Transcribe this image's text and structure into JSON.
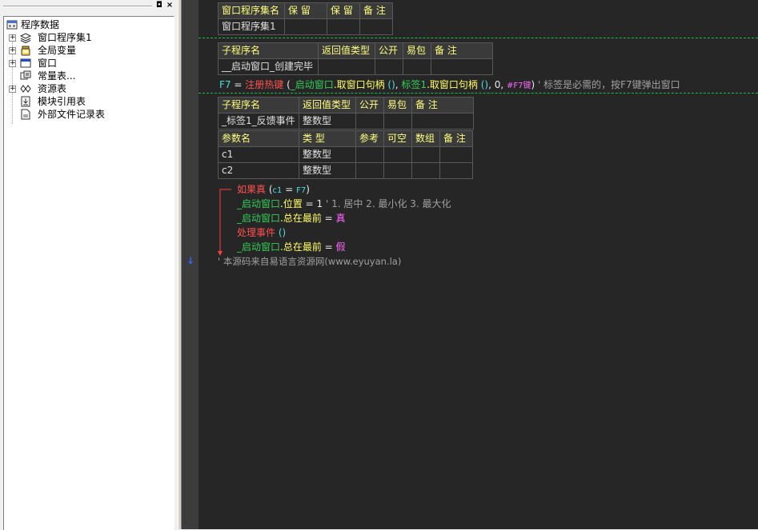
{
  "left_panel": {
    "pin_icon": "◘",
    "close_icon": "×",
    "tree": [
      {
        "label": "程序数据",
        "icon": "program-data-icon"
      },
      {
        "label": "窗口程序集1",
        "icon": "layers-icon"
      },
      {
        "label": "全局变量",
        "icon": "variable-jar-icon"
      },
      {
        "label": "窗口",
        "icon": "window-icon"
      },
      {
        "label": "常量表...",
        "icon": "constants-icon"
      },
      {
        "label": "资源表",
        "icon": "resources-icon"
      },
      {
        "label": "模块引用表",
        "icon": "module-icon"
      },
      {
        "label": "外部文件记录表",
        "icon": "file-icon"
      }
    ],
    "expander_symbol": "+"
  },
  "gutter": {
    "arrow": "↓"
  },
  "editor": {
    "assembly_table": {
      "headers": [
        "窗口程序集名",
        "保 留",
        "保 留",
        "备 注"
      ],
      "row": [
        "窗口程序集1",
        "",
        "",
        ""
      ]
    },
    "sub1_table": {
      "headers": [
        "子程序名",
        "返回值类型",
        "公开",
        "易包",
        "备 注"
      ],
      "row": [
        "__启动窗口_创建完毕",
        "",
        "",
        "",
        ""
      ]
    },
    "line1": {
      "var": "F7",
      "eq": " = ",
      "func": "注册热键",
      "open": " (",
      "arg1_obj": "_启动窗口",
      "arg1_method": ".取窗口句柄",
      "arg1_paren": " ()",
      "comma1": ", ",
      "arg2_obj": "标签1",
      "arg2_method": ".取窗口句柄",
      "arg2_paren": " ()",
      "comma2": ", 0, ",
      "arg4": "#F7键",
      "close": ")",
      "comment": "  ' 标签是必需的，按F7键弹出窗口"
    },
    "sub2_table": {
      "headers": [
        "子程序名",
        "返回值类型",
        "公开",
        "易包",
        "备 注"
      ],
      "row": [
        "_标签1_反馈事件",
        "整数型",
        "",
        "",
        ""
      ]
    },
    "param_table": {
      "headers": [
        "参数名",
        "类 型",
        "参考",
        "可空",
        "数组",
        "备 注"
      ],
      "rows": [
        [
          "c1",
          "整数型",
          "",
          "",
          "",
          ""
        ],
        [
          "c2",
          "整数型",
          "",
          "",
          "",
          ""
        ]
      ]
    },
    "code": {
      "if_keyword": "如果真",
      "if_cond_open": " (",
      "if_cond_var": "c1",
      "if_cond_eq": " = ",
      "if_cond_val": "F7",
      "if_cond_close": ")",
      "l2_obj": "_启动窗口",
      "l2_prop": ".位置",
      "l2_eq": " = ",
      "l2_val": "1",
      "l2_comment": "  ' 1. 居中  2. 最小化   3. 最大化",
      "l3_obj": "_启动窗口",
      "l3_prop": ".总在最前",
      "l3_eq": " = ",
      "l3_val": "真",
      "l4_func": "处理事件",
      "l4_paren": " ()",
      "l5_obj": "_启动窗口",
      "l5_prop": ".总在最前",
      "l5_eq": " = ",
      "l5_val": "假",
      "footer_comment": "' 本源码来自易语言资源网(www.eyuyan.la)"
    }
  },
  "colors": {
    "editor_bg": "#262626",
    "table_header": "#ffff80",
    "green": "#33cc55",
    "magenta": "#ff66ff",
    "cyan": "#4ddddd",
    "red": "#ff5050",
    "separator": "#21b84a"
  }
}
